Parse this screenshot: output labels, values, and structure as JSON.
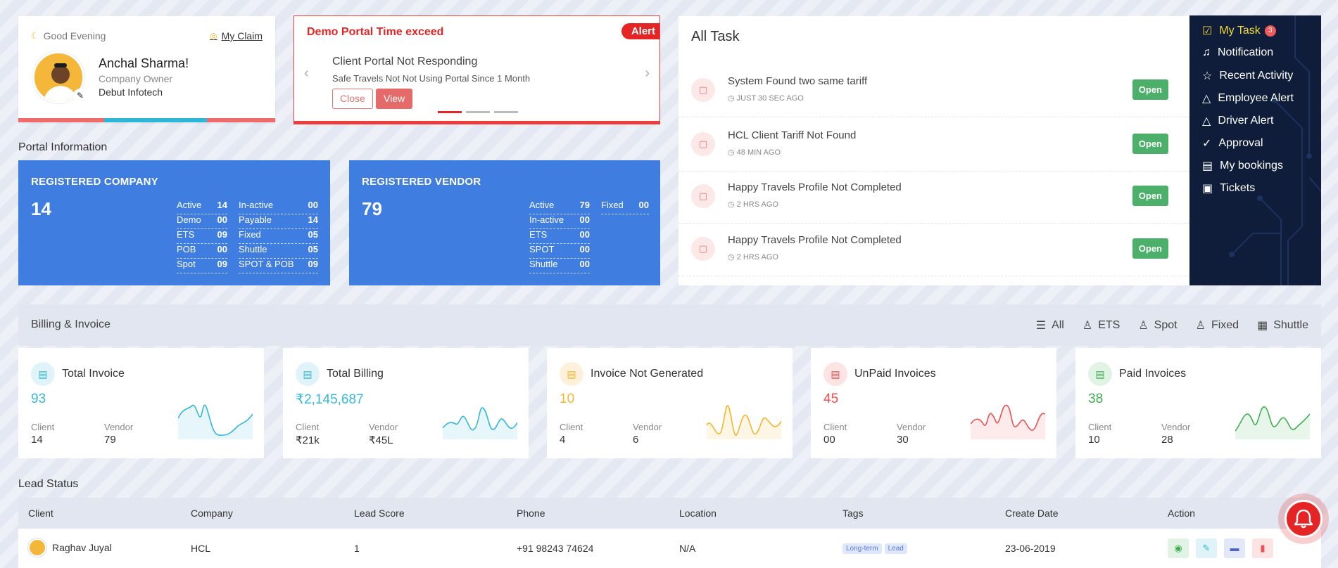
{
  "greeting": {
    "text": "Good Evening",
    "claim_link": "My Claim",
    "name": "Anchal Sharma!",
    "role": "Company Owner",
    "company": "Debut Infotech"
  },
  "alert": {
    "title": "Demo Portal Time exceed",
    "badge": "Alert",
    "message": "Client Portal Not Responding",
    "sub": "Safe Travels Not Not Using Portal Since 1 Month",
    "close_label": "Close",
    "view_label": "View"
  },
  "portal": {
    "section_label": "Portal Information",
    "company": {
      "title": "REGISTERED COMPANY",
      "count": "14",
      "stats": [
        {
          "label": "Active",
          "value": "14"
        },
        {
          "label": "In-active",
          "value": "00"
        },
        {
          "label": "Demo",
          "value": "00"
        },
        {
          "label": "Payable",
          "value": "14"
        },
        {
          "label": "ETS",
          "value": "09"
        },
        {
          "label": "Fixed",
          "value": "05"
        },
        {
          "label": "POB",
          "value": "00"
        },
        {
          "label": "Shuttle",
          "value": "05"
        },
        {
          "label": "Spot",
          "value": "09"
        },
        {
          "label": "SPOT & POB",
          "value": "09"
        }
      ]
    },
    "vendor": {
      "title": "REGISTERED VENDOR",
      "count": "79",
      "stats": [
        {
          "label": "Active",
          "value": "79"
        },
        {
          "label": "Fixed",
          "value": "00"
        },
        {
          "label": "In-active",
          "value": "00"
        },
        {
          "label": "ETS",
          "value": "00"
        },
        {
          "label": "SPOT",
          "value": "00"
        },
        {
          "label": "Shuttle",
          "value": "00"
        }
      ]
    }
  },
  "tasks": {
    "title": "All Task",
    "open_label": "Open",
    "items": [
      {
        "title": "System Found two same tariff",
        "time": "JUST 30 SEC AGO"
      },
      {
        "title": "HCL Client Tariff Not Found",
        "time": "48 MIN AGO"
      },
      {
        "title": "Happy Travels Profile Not Completed",
        "time": "2 HRS AGO"
      },
      {
        "title": "Happy Travels Profile Not Completed",
        "time": "2 HRS AGO"
      }
    ]
  },
  "side_menu": {
    "items": [
      {
        "label": "My Task",
        "icon": "checkbox-icon",
        "count": "3",
        "active": true
      },
      {
        "label": "Notification",
        "icon": "bell-icon"
      },
      {
        "label": "Recent Activity",
        "icon": "star-icon"
      },
      {
        "label": "Employee Alert",
        "icon": "warning-icon"
      },
      {
        "label": "Driver Alert",
        "icon": "warning-icon"
      },
      {
        "label": "Approval",
        "icon": "double-check-icon"
      },
      {
        "label": "My bookings",
        "icon": "book-icon"
      },
      {
        "label": "Tickets",
        "icon": "ticket-icon"
      }
    ]
  },
  "billing": {
    "title": "Billing & Invoice",
    "filters": [
      "All",
      "ETS",
      "Spot",
      "Fixed",
      "Shuttle"
    ],
    "client_label": "Client",
    "vendor_label": "Vendor",
    "cards": [
      {
        "title": "Total Invoice",
        "value": "93",
        "client": "14",
        "vendor": "79",
        "color": "#35b8d8",
        "bg": "#dff3f9"
      },
      {
        "title": "Total Billing",
        "value": "₹2,145,687",
        "client": "₹21k",
        "vendor": "₹45L",
        "color": "#35b8d8",
        "bg": "#dff3f9"
      },
      {
        "title": "Invoice Not Generated",
        "value": "10",
        "client": "4",
        "vendor": "6",
        "color": "#f5b62b",
        "bg": "#fdf1dc"
      },
      {
        "title": "UnPaid Invoices",
        "value": "45",
        "client": "00",
        "vendor": "30",
        "color": "#ec5050",
        "bg": "#fde4e4"
      },
      {
        "title": "Paid Invoices",
        "value": "38",
        "client": "10",
        "vendor": "28",
        "color": "#3fae52",
        "bg": "#e1f3e4"
      }
    ]
  },
  "leads": {
    "title": "Lead Status",
    "columns": [
      "Client",
      "Company",
      "Lead Score",
      "Phone",
      "Location",
      "Tags",
      "Create Date",
      "Action"
    ],
    "rows": [
      {
        "client": "Raghav Juyal",
        "company": "HCL",
        "score": "1",
        "phone": "+91 98243 74624",
        "location": "N/A",
        "tags": [
          "Long-term",
          "Lead"
        ],
        "date": "23-06-2019"
      }
    ]
  }
}
